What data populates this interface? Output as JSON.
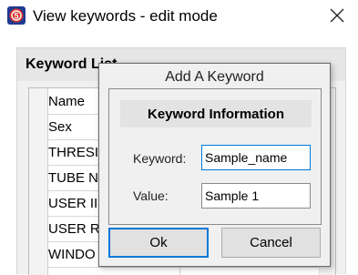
{
  "window": {
    "title": "View keywords - edit mode",
    "icon": "app-badge-icon",
    "close_icon": "close-icon"
  },
  "keyword_list": {
    "title": "Keyword List",
    "rows": [
      {
        "name": "Name"
      },
      {
        "name": "Sex"
      },
      {
        "name": "THRESI"
      },
      {
        "name": "TUBE N"
      },
      {
        "name": "USER II"
      },
      {
        "name": "USER R"
      },
      {
        "name": "WINDO"
      }
    ]
  },
  "dialog": {
    "title": "Add A Keyword",
    "section_title": "Keyword Information",
    "keyword_label": "Keyword:",
    "keyword_value": "Sample_name",
    "value_label": "Value:",
    "value_value": "Sample 1",
    "ok_label": "Ok",
    "cancel_label": "Cancel"
  },
  "colors": {
    "accent": "#0078d7",
    "app_icon_red": "#d9342b"
  }
}
